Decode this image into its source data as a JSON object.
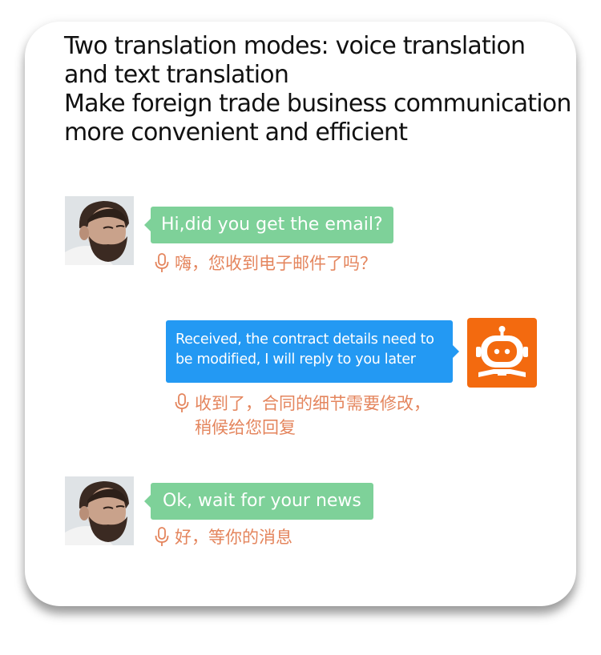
{
  "headline": {
    "lines": [
      "Two translation modes: voice translation",
      "and text translation",
      "Make foreign trade business communication",
      "more convenient and efficient"
    ]
  },
  "messages": [
    {
      "text": "Hi,did you get the email?",
      "translation": [
        "嗨，您收到电子邮件了吗？"
      ]
    },
    {
      "text": [
        "Received, the contract details need to",
        "be modified, I will reply to you later"
      ],
      "translation": [
        "收到了，合同的细节需要修改，",
        "稍候给您回复"
      ]
    },
    {
      "text": "Ok, wait for your news",
      "translation": [
        "好，等你的消息"
      ]
    }
  ],
  "colors": {
    "incoming_bubble": "#7ed199",
    "outgoing_bubble": "#2399f3",
    "translation_text": "#e4855d",
    "bot_background": "#f36a0f"
  },
  "icons": {
    "mic": "microphone-icon",
    "bot": "robot-icon",
    "avatar": "user-avatar"
  }
}
